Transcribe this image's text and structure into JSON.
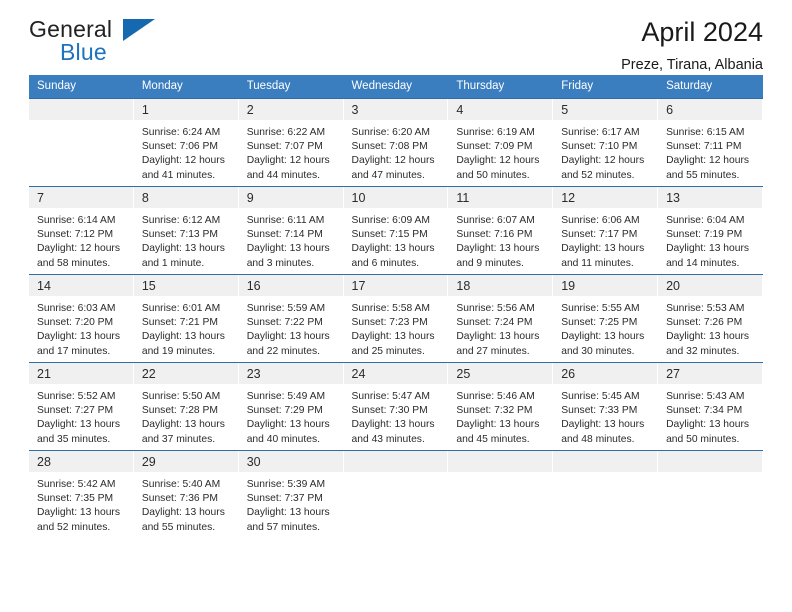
{
  "brand": {
    "name_top": "General",
    "name_bottom": "Blue",
    "flag_icon": "blue-flag-triangle"
  },
  "header": {
    "month_title": "April 2024",
    "location": "Preze, Tirana, Albania"
  },
  "colors": {
    "header_blue": "#3a7ebf",
    "row_border_blue": "#2f6ea5",
    "daynum_band": "#f0f0f0",
    "brand_blue": "#1f72bd"
  },
  "weekdays": [
    "Sunday",
    "Monday",
    "Tuesday",
    "Wednesday",
    "Thursday",
    "Friday",
    "Saturday"
  ],
  "weeks": [
    [
      {
        "day": "",
        "lines": [
          "",
          "",
          "",
          ""
        ],
        "empty": true
      },
      {
        "day": "1",
        "lines": [
          "Sunrise: 6:24 AM",
          "Sunset: 7:06 PM",
          "Daylight: 12 hours",
          "and 41 minutes."
        ]
      },
      {
        "day": "2",
        "lines": [
          "Sunrise: 6:22 AM",
          "Sunset: 7:07 PM",
          "Daylight: 12 hours",
          "and 44 minutes."
        ]
      },
      {
        "day": "3",
        "lines": [
          "Sunrise: 6:20 AM",
          "Sunset: 7:08 PM",
          "Daylight: 12 hours",
          "and 47 minutes."
        ]
      },
      {
        "day": "4",
        "lines": [
          "Sunrise: 6:19 AM",
          "Sunset: 7:09 PM",
          "Daylight: 12 hours",
          "and 50 minutes."
        ]
      },
      {
        "day": "5",
        "lines": [
          "Sunrise: 6:17 AM",
          "Sunset: 7:10 PM",
          "Daylight: 12 hours",
          "and 52 minutes."
        ]
      },
      {
        "day": "6",
        "lines": [
          "Sunrise: 6:15 AM",
          "Sunset: 7:11 PM",
          "Daylight: 12 hours",
          "and 55 minutes."
        ]
      }
    ],
    [
      {
        "day": "7",
        "lines": [
          "Sunrise: 6:14 AM",
          "Sunset: 7:12 PM",
          "Daylight: 12 hours",
          "and 58 minutes."
        ]
      },
      {
        "day": "8",
        "lines": [
          "Sunrise: 6:12 AM",
          "Sunset: 7:13 PM",
          "Daylight: 13 hours",
          "and 1 minute."
        ]
      },
      {
        "day": "9",
        "lines": [
          "Sunrise: 6:11 AM",
          "Sunset: 7:14 PM",
          "Daylight: 13 hours",
          "and 3 minutes."
        ]
      },
      {
        "day": "10",
        "lines": [
          "Sunrise: 6:09 AM",
          "Sunset: 7:15 PM",
          "Daylight: 13 hours",
          "and 6 minutes."
        ]
      },
      {
        "day": "11",
        "lines": [
          "Sunrise: 6:07 AM",
          "Sunset: 7:16 PM",
          "Daylight: 13 hours",
          "and 9 minutes."
        ]
      },
      {
        "day": "12",
        "lines": [
          "Sunrise: 6:06 AM",
          "Sunset: 7:17 PM",
          "Daylight: 13 hours",
          "and 11 minutes."
        ]
      },
      {
        "day": "13",
        "lines": [
          "Sunrise: 6:04 AM",
          "Sunset: 7:19 PM",
          "Daylight: 13 hours",
          "and 14 minutes."
        ]
      }
    ],
    [
      {
        "day": "14",
        "lines": [
          "Sunrise: 6:03 AM",
          "Sunset: 7:20 PM",
          "Daylight: 13 hours",
          "and 17 minutes."
        ]
      },
      {
        "day": "15",
        "lines": [
          "Sunrise: 6:01 AM",
          "Sunset: 7:21 PM",
          "Daylight: 13 hours",
          "and 19 minutes."
        ]
      },
      {
        "day": "16",
        "lines": [
          "Sunrise: 5:59 AM",
          "Sunset: 7:22 PM",
          "Daylight: 13 hours",
          "and 22 minutes."
        ]
      },
      {
        "day": "17",
        "lines": [
          "Sunrise: 5:58 AM",
          "Sunset: 7:23 PM",
          "Daylight: 13 hours",
          "and 25 minutes."
        ]
      },
      {
        "day": "18",
        "lines": [
          "Sunrise: 5:56 AM",
          "Sunset: 7:24 PM",
          "Daylight: 13 hours",
          "and 27 minutes."
        ]
      },
      {
        "day": "19",
        "lines": [
          "Sunrise: 5:55 AM",
          "Sunset: 7:25 PM",
          "Daylight: 13 hours",
          "and 30 minutes."
        ]
      },
      {
        "day": "20",
        "lines": [
          "Sunrise: 5:53 AM",
          "Sunset: 7:26 PM",
          "Daylight: 13 hours",
          "and 32 minutes."
        ]
      }
    ],
    [
      {
        "day": "21",
        "lines": [
          "Sunrise: 5:52 AM",
          "Sunset: 7:27 PM",
          "Daylight: 13 hours",
          "and 35 minutes."
        ]
      },
      {
        "day": "22",
        "lines": [
          "Sunrise: 5:50 AM",
          "Sunset: 7:28 PM",
          "Daylight: 13 hours",
          "and 37 minutes."
        ]
      },
      {
        "day": "23",
        "lines": [
          "Sunrise: 5:49 AM",
          "Sunset: 7:29 PM",
          "Daylight: 13 hours",
          "and 40 minutes."
        ]
      },
      {
        "day": "24",
        "lines": [
          "Sunrise: 5:47 AM",
          "Sunset: 7:30 PM",
          "Daylight: 13 hours",
          "and 43 minutes."
        ]
      },
      {
        "day": "25",
        "lines": [
          "Sunrise: 5:46 AM",
          "Sunset: 7:32 PM",
          "Daylight: 13 hours",
          "and 45 minutes."
        ]
      },
      {
        "day": "26",
        "lines": [
          "Sunrise: 5:45 AM",
          "Sunset: 7:33 PM",
          "Daylight: 13 hours",
          "and 48 minutes."
        ]
      },
      {
        "day": "27",
        "lines": [
          "Sunrise: 5:43 AM",
          "Sunset: 7:34 PM",
          "Daylight: 13 hours",
          "and 50 minutes."
        ]
      }
    ],
    [
      {
        "day": "28",
        "lines": [
          "Sunrise: 5:42 AM",
          "Sunset: 7:35 PM",
          "Daylight: 13 hours",
          "and 52 minutes."
        ]
      },
      {
        "day": "29",
        "lines": [
          "Sunrise: 5:40 AM",
          "Sunset: 7:36 PM",
          "Daylight: 13 hours",
          "and 55 minutes."
        ]
      },
      {
        "day": "30",
        "lines": [
          "Sunrise: 5:39 AM",
          "Sunset: 7:37 PM",
          "Daylight: 13 hours",
          "and 57 minutes."
        ]
      },
      {
        "day": "",
        "lines": [
          "",
          "",
          "",
          ""
        ],
        "empty": true
      },
      {
        "day": "",
        "lines": [
          "",
          "",
          "",
          ""
        ],
        "empty": true
      },
      {
        "day": "",
        "lines": [
          "",
          "",
          "",
          ""
        ],
        "empty": true
      },
      {
        "day": "",
        "lines": [
          "",
          "",
          "",
          ""
        ],
        "empty": true
      }
    ]
  ]
}
